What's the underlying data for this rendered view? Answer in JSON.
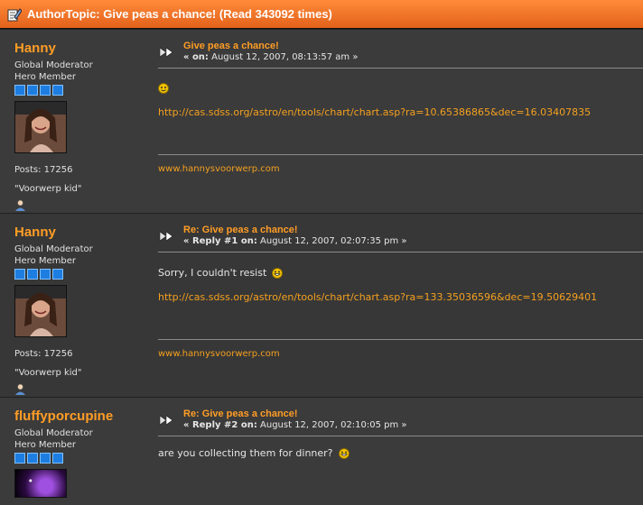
{
  "thread": {
    "author_label": "Author",
    "topic_title": "Topic: Give peas a chance!  (Read 343092 times)"
  },
  "posts": [
    {
      "poster": {
        "name": "Hanny",
        "group": "Global Moderator",
        "rank": "Hero Member",
        "stars": 4,
        "posts": "Posts: 17256",
        "personal_text": "\"Voorwerp kid\""
      },
      "subject": "Give peas a chance!",
      "meta_prefix": "« on:",
      "date": "August 12, 2007, 08:13:57 am »",
      "body_text": "",
      "link": "http://cas.sdss.org/astro/en/tools/chart/chart.asp?ra=10.65386865&dec=16.03407835",
      "signature": "www.hannysvoorwerp.com"
    },
    {
      "poster": {
        "name": "Hanny",
        "group": "Global Moderator",
        "rank": "Hero Member",
        "stars": 4,
        "posts": "Posts: 17256",
        "personal_text": "\"Voorwerp kid\""
      },
      "subject": "Re: Give peas a chance!",
      "meta_prefix": "« Reply #1 on:",
      "date": "August 12, 2007, 02:07:35 pm »",
      "body_text": "Sorry, I couldn't resist",
      "link": "http://cas.sdss.org/astro/en/tools/chart/chart.asp?ra=133.35036596&dec=19.50629401",
      "signature": "www.hannysvoorwerp.com"
    },
    {
      "poster": {
        "name": "fluffyporcupine",
        "group": "Global Moderator",
        "rank": "Hero Member",
        "stars": 4
      },
      "subject": "Re: Give peas a chance!",
      "meta_prefix": "« Reply #2 on:",
      "date": "August 12, 2007, 02:10:05 pm »",
      "body_text": "are you collecting them for dinner?"
    }
  ],
  "icons": {
    "topic": "edit-page-icon",
    "post": "double-arrow-icon",
    "smiley": "smiley-icon",
    "profile": "profile-user-icon"
  },
  "colors": {
    "header_orange": "#e2621b",
    "name_orange": "#ff9d25",
    "link_orange": "#f4a01f",
    "star_blue": "#1e7de0"
  }
}
